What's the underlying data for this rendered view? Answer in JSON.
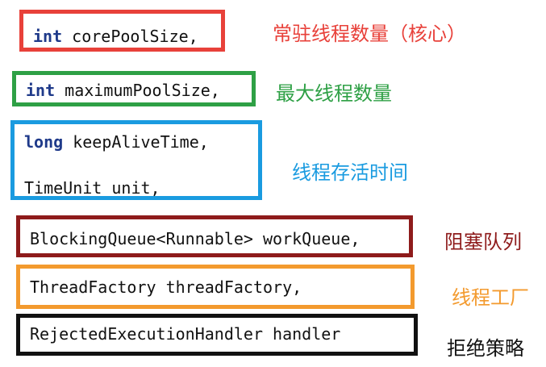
{
  "params": [
    {
      "lines": [
        {
          "kw": "int",
          "text": " corePoolSize,"
        }
      ],
      "label": "常驻线程数量（核心）",
      "color": "#e8413a"
    },
    {
      "lines": [
        {
          "kw": "int",
          "text": " maximumPoolSize,"
        }
      ],
      "label": "最大线程数量",
      "color": "#2ea045"
    },
    {
      "lines": [
        {
          "kw": "long",
          "text": " keepAliveTime,"
        },
        {
          "kw": "",
          "text": "TimeUnit unit,"
        }
      ],
      "label": "线程存活时间",
      "color": "#1a9be0"
    },
    {
      "lines": [
        {
          "kw": "",
          "text": "BlockingQueue<Runnable> workQueue,"
        }
      ],
      "label": "阻塞队列",
      "color": "#8e1b1b"
    },
    {
      "lines": [
        {
          "kw": "",
          "text": "ThreadFactory threadFactory,"
        }
      ],
      "label": "线程工厂",
      "color": "#f39a2e"
    },
    {
      "lines": [
        {
          "kw": "",
          "text": "RejectedExecutionHandler handler"
        }
      ],
      "label": "拒绝策略",
      "color": "#111111"
    }
  ]
}
